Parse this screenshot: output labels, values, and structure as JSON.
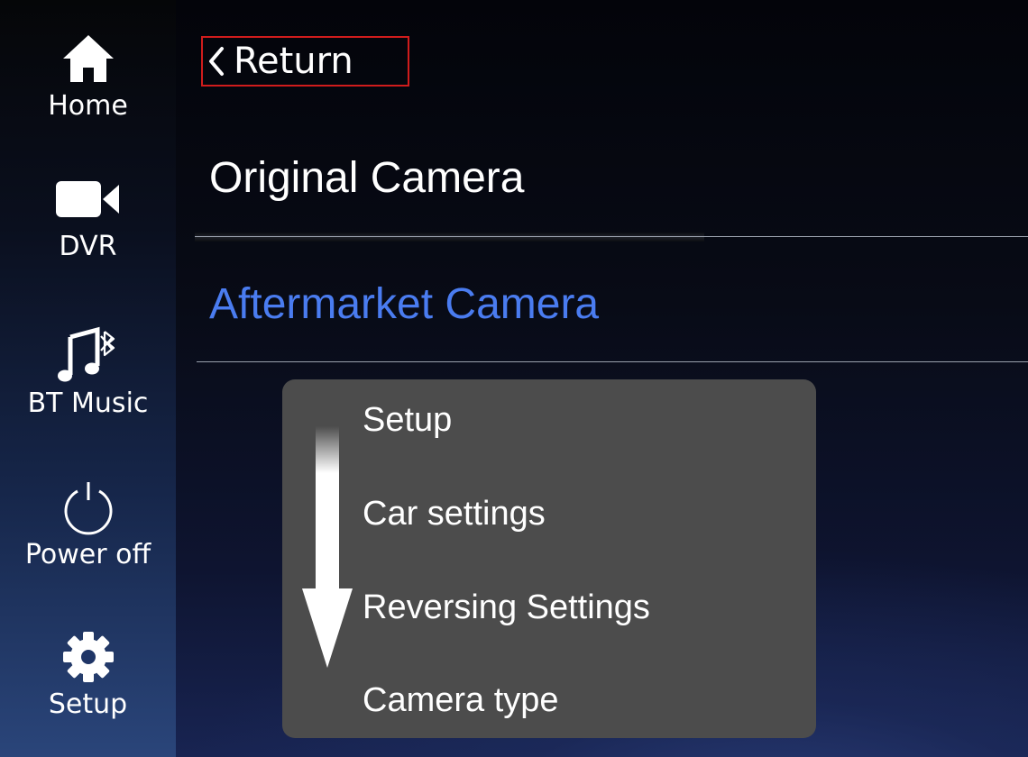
{
  "sidebar": {
    "items": [
      {
        "label": "Home",
        "icon": "home-icon"
      },
      {
        "label": "DVR",
        "icon": "video-camera-icon"
      },
      {
        "label": "BT Music",
        "icon": "bluetooth-music-icon"
      },
      {
        "label": "Power off",
        "icon": "power-icon"
      },
      {
        "label": "Setup",
        "icon": "gear-icon"
      }
    ]
  },
  "header": {
    "return_label": "Return",
    "return_icon": "chevron-left-icon",
    "highlight_color": "#d01c1c"
  },
  "options": [
    {
      "label": "Original Camera",
      "selected": false
    },
    {
      "label": "Aftermarket Camera",
      "selected": true
    }
  ],
  "accent_color": "#4a7cf0",
  "steps": {
    "items": [
      "Setup",
      "Car settings",
      "Reversing Settings",
      "Camera type"
    ],
    "arrow_icon": "down-arrow-icon"
  }
}
